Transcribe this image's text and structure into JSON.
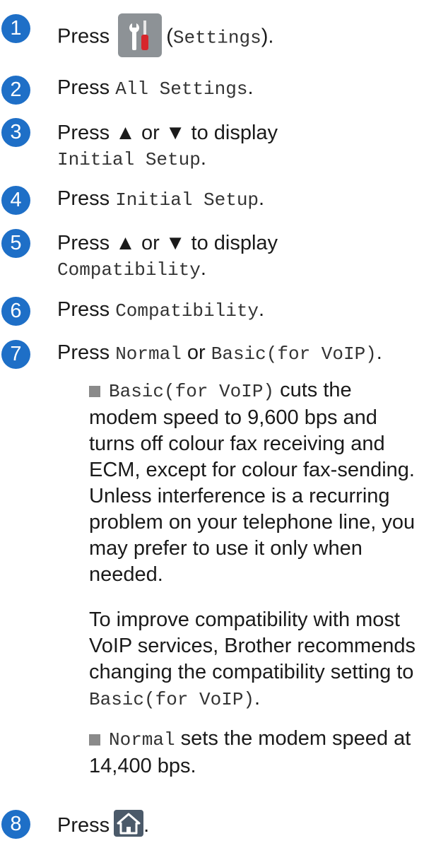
{
  "steps": [
    {
      "num": "1",
      "press": "Press",
      "open_paren": "(",
      "mono": "Settings",
      "close": ")."
    },
    {
      "num": "2",
      "press": "Press",
      "mono": "All Settings",
      "close": "."
    },
    {
      "num": "3",
      "line1": "Press ▲ or ▼ to display",
      "mono": "Initial Setup",
      "close": "."
    },
    {
      "num": "4",
      "press": "Press",
      "mono": "Initial Setup",
      "close": "."
    },
    {
      "num": "5",
      "line1": "Press ▲ or ▼ to display",
      "mono": "Compatibility",
      "close": "."
    },
    {
      "num": "6",
      "press": "Press",
      "mono": "Compatibility",
      "close": "."
    },
    {
      "num": "7",
      "press": "Press",
      "mono1": "Normal",
      "or": "or",
      "mono2": "Basic(for VoIP)",
      "close": "."
    },
    {
      "num": "8",
      "press": "Press",
      "close": "."
    }
  ],
  "notes": {
    "bullet1": {
      "mono": "Basic(for VoIP)",
      "lines": [
        " cuts the",
        "modem speed to 9,600 bps and",
        "turns off colour fax receiving and",
        "ECM, except for colour fax-sending.",
        "Unless interference is a recurring",
        "problem on your telephone line, you",
        "may prefer to use it only when",
        "needed."
      ]
    },
    "para": {
      "lines": [
        "To improve compatibility with most",
        "VoIP services, Brother recommends",
        "changing the compatibility setting to"
      ],
      "mono": "Basic(for VoIP)",
      "close": "."
    },
    "bullet2": {
      "mono": "Normal",
      "line1": " sets the modem speed at",
      "line2": "14,400 bps."
    }
  },
  "icons": {
    "settings": "settings-tools-icon",
    "home": "home-icon"
  },
  "colors": {
    "step_number_bg": "#1e6fc7",
    "settings_icon_bg": "#8d9296",
    "home_icon_bg": "#4b5a6a",
    "bullet": "#8a8a8a"
  }
}
